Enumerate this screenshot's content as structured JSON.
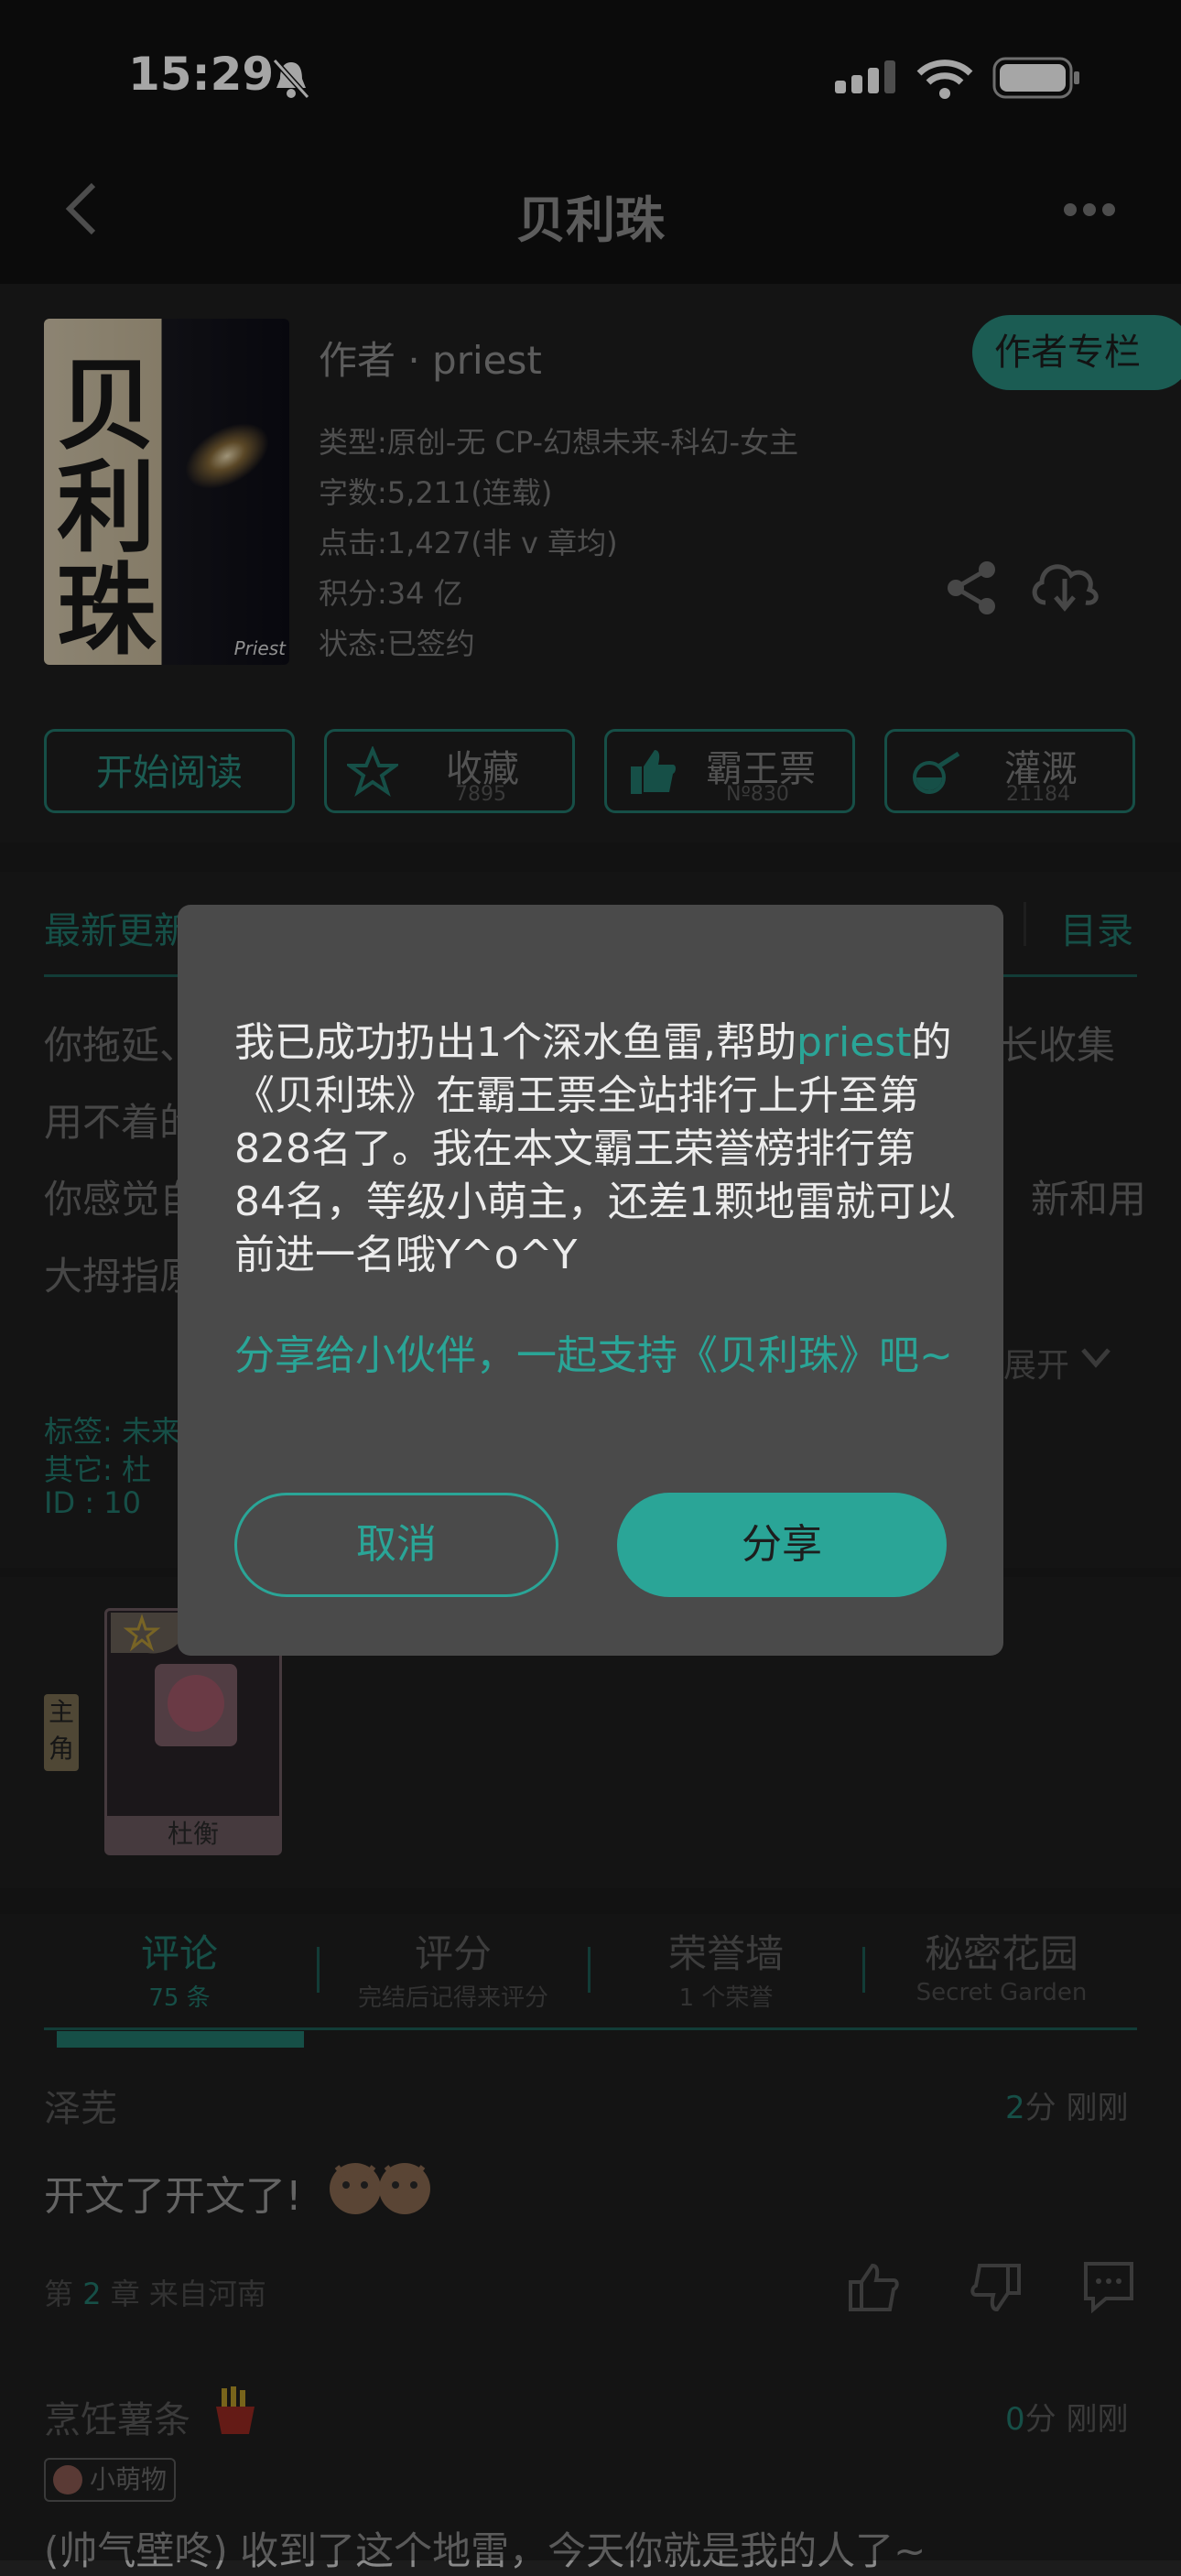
{
  "status_bar": {
    "time": "15:29"
  },
  "nav": {
    "title": "贝利珠"
  },
  "book": {
    "cover_chars": [
      "贝",
      "利",
      "珠"
    ],
    "cover_signature": "Priest",
    "author": "作者 · priest",
    "author_column": "作者专栏",
    "type": "类型:原创-无 CP-幻想未来-科幻-女主",
    "words": "字数:5,211(连载)",
    "clicks": "点击:1,427(非 v 章均)",
    "points": "积分:34 亿",
    "status": "状态:已签约"
  },
  "actions": {
    "start_reading": "开始阅读",
    "collect": {
      "label": "收藏",
      "count": "7895"
    },
    "overlord": {
      "label": "霸王票",
      "count": "Nº830"
    },
    "irrigate": {
      "label": "灌溉",
      "count": "21184"
    }
  },
  "update": {
    "tab_latest": "最新更新",
    "tab_catalog": "目录",
    "line1_left": "你拖延、",
    "line1_right": "长收集",
    "line2_left": "用不着的",
    "line3_left": "你感觉自",
    "line3_right": "新和用",
    "line4_left": "大拇指原",
    "expand": "展开",
    "tags": "标签: 未来",
    "other": "其它: 杜",
    "id": "ID : 10"
  },
  "characters": {
    "role_label": "主角",
    "name": "杜衡"
  },
  "tabs": [
    {
      "label": "评论",
      "sub": "75 条"
    },
    {
      "label": "评分",
      "sub": "完结后记得来评分"
    },
    {
      "label": "荣誉墙",
      "sub": "1 个荣誉"
    },
    {
      "label": "秘密花园",
      "sub": "Secret Garden"
    }
  ],
  "comments": [
    {
      "user": "泽芜",
      "score": "2",
      "score_unit": "分",
      "time": "刚刚",
      "text": "开文了开文了!",
      "meta_pre": "第",
      "chapter": "2",
      "meta_post": "章 来自河南"
    },
    {
      "user": "烹饪薯条",
      "score": "0",
      "score_unit": "分",
      "time": "刚刚",
      "badge": "小萌物",
      "text": "(帅气壁咚) 收到了这个地雷，今天你就是我的人了~"
    }
  ],
  "modal": {
    "msg_part1": "我已成功扔出1个深水鱼雷,帮助",
    "msg_author": "priest",
    "msg_part2": "的《贝利珠》在霸王票全站排行上升至第828名了。我在本文霸王荣誉榜排行第84名，等级小萌主，还差1颗地雷就可以前进一名哦Y^o^Y",
    "share_msg": "分享给小伙伴，一起支持《贝利珠》吧~",
    "cancel": "取消",
    "share": "分享"
  },
  "colors": {
    "accent": "#2aa597",
    "dim_accent": "#237a6e",
    "background": "#1f1f1f"
  }
}
